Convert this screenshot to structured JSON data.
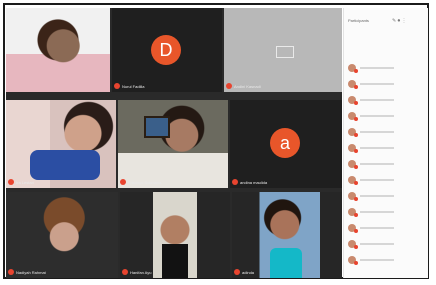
{
  "meeting": {
    "tiles": [
      {
        "name": "",
        "kind": "video"
      },
      {
        "name": "Nurul Fadilla",
        "kind": "avatar",
        "letter": "D"
      },
      {
        "name": "Andini Kasnadi",
        "kind": "shared"
      },
      {
        "name": "Ira Lestari",
        "kind": "video"
      },
      {
        "name": "Frisdoyo Sukmana",
        "kind": "video"
      },
      {
        "name": "andina maulida",
        "kind": "avatar",
        "letter": "a"
      },
      {
        "name": "Nadiyah Rahmat",
        "kind": "video"
      },
      {
        "name": "Hanifan Ayu",
        "kind": "video"
      },
      {
        "name": "adinda",
        "kind": "video"
      }
    ]
  },
  "participants_panel": {
    "title": "Participants",
    "rows": 13
  },
  "colors": {
    "avatar_d": "#e8562a",
    "avatar_a": "#e8562a",
    "mic_muted": "#e8442f"
  }
}
